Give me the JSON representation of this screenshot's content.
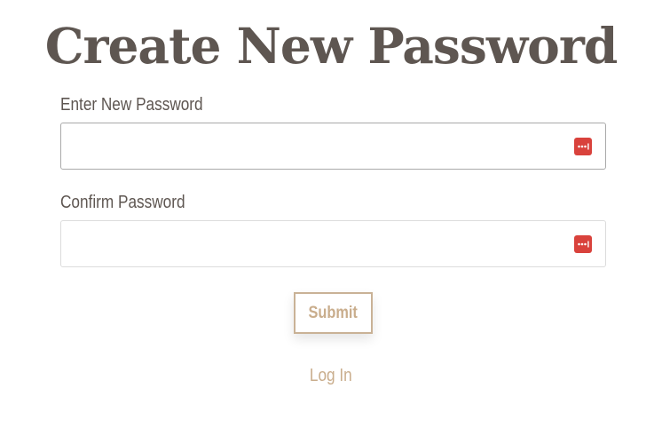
{
  "page": {
    "title": "Create New Password"
  },
  "form": {
    "new_password": {
      "label": "Enter New Password",
      "value": "",
      "icon": "password-manager-icon"
    },
    "confirm_password": {
      "label": "Confirm Password",
      "value": "",
      "icon": "password-manager-icon"
    },
    "submit_label": "Submit"
  },
  "footer": {
    "login_link": "Log In"
  },
  "colors": {
    "title": "#5e5651",
    "accent": "#c9ad8c",
    "icon": "#d9423c"
  }
}
